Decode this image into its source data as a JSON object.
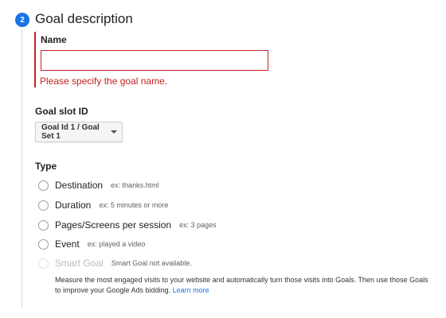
{
  "step": {
    "number": "2",
    "title": "Goal description"
  },
  "name_field": {
    "label": "Name",
    "value": "",
    "placeholder": "",
    "error": "Please specify the goal name."
  },
  "slot": {
    "label": "Goal slot ID",
    "selected": "Goal Id 1 / Goal Set 1"
  },
  "type": {
    "label": "Type",
    "options": [
      {
        "label": "Destination",
        "hint": "ex: thanks.html",
        "disabled": false
      },
      {
        "label": "Duration",
        "hint": "ex: 5 minutes or more",
        "disabled": false
      },
      {
        "label": "Pages/Screens per session",
        "hint": "ex: 3 pages",
        "disabled": false
      },
      {
        "label": "Event",
        "hint": "ex: played a video",
        "disabled": false
      },
      {
        "label": "Smart Goal",
        "hint": "Smart Goal not available.",
        "disabled": true
      }
    ],
    "smart_goal_description": "Measure the most engaged visits to your website and automatically turn those visits into Goals. Then use those Goals to improve your Google Ads bidding.",
    "learn_more": "Learn more"
  },
  "colors": {
    "accent": "#1a73e8",
    "error": "#c5221f"
  }
}
